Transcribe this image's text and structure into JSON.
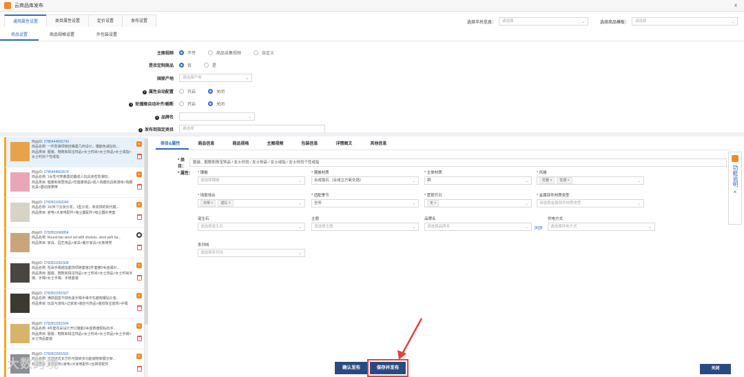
{
  "window": {
    "title": "云商品库发布",
    "close": "x"
  },
  "top_tabs": [
    "通用属性设置",
    "类目属性设置",
    "定价设置",
    "发布设置"
  ],
  "top_selects": {
    "template_label": "选择半托信息：",
    "template_placeholder": "请选择",
    "product_template_label": "选择商品模板：",
    "product_template_placeholder": "请选择"
  },
  "sub_tabs": [
    "商品设置",
    "商品规格设置",
    "外包装设置"
  ],
  "form": {
    "main_video": {
      "label": "主图视频",
      "options": [
        "不传",
        "商品采集视频",
        "自定义"
      ]
    },
    "customized": {
      "label": "是否定制商品",
      "options": [
        "否",
        "是"
      ]
    },
    "origin": {
      "label": "国家产地",
      "placeholder": "请选择产地"
    },
    "auto_attr": {
      "label": "属性自动配置",
      "options": [
        "开启",
        "关闭"
      ]
    },
    "carousel": {
      "label": "轮播图自动补齐/截断",
      "options": [
        "开启",
        "关闭"
      ]
    },
    "brand": {
      "label": "品牌名"
    },
    "publish_category": {
      "label": "发布到指定类目",
      "placeholder": "请选择"
    }
  },
  "products": [
    {
      "id_label": "商品ID:",
      "id": "2786444665743",
      "name_label": "商品名称:",
      "name": "一件防弹项链挂嘴遇几何设计，镶嵌色减钻石...",
      "cat_label": "商品类目:",
      "cat": "服装、鞋靴和珠宝饰品>女士时尚>女士饰品>女士戒指>女士时尚个性戒指"
    },
    {
      "id_label": "商品ID:",
      "id": "2786444653576",
      "name_label": "商品名称:",
      "name": "1女性可穿戴震动器成人玩具亲密防潮玩...",
      "cat_label": "商品类目:",
      "cat": "健康和家居用品>性健康用品>成人情趣玩具和游戏>情趣玩具>震动按摩棒"
    },
    {
      "id_label": "商品ID:",
      "id": "2782811662049",
      "name_label": "商品名称:",
      "name": "10/米寸云状沙发，1型沙发，单双排的现代模...",
      "cat_label": "商品类目:",
      "cat": "家电>大家电配件>吸尘器配件>吸尘器外壳套"
    },
    {
      "id_label": "商品ID:",
      "id": "2782811660854",
      "name_label": "商品名称:",
      "name": "Round bar stool set with shelves, stool with ba...",
      "cat_label": "商品类目:",
      "cat": "家具、园艺用品>家具>餐厅家具>长条椅凳"
    },
    {
      "id_label": "商品ID:",
      "id": "2782811551509",
      "name_label": "商品名称:",
      "name": "花朵手镯戒指套饰项链套装3件套镀24k金属针...",
      "cat_label": "商品类目:",
      "cat": "服装、鞋靴和珠宝饰品>女士时尚>女士饰品>女士时尚手链、手镯>女士手镯、手链套装"
    },
    {
      "id_label": "商品ID:",
      "id": "2782811551507",
      "name_label": "商品名称:",
      "name": "满拼圆盒不掉色黑手镯手串中东越南镶钻沙金...",
      "cat_label": "商品类目:",
      "cat": "玩具与游戏>过家家>装扮与饰品>装扮珠宝首饰>手镯"
    },
    {
      "id_label": "商品ID:",
      "id": "2782811551504",
      "name_label": "商品名称:",
      "name": "4件套花朵设计开口镶嵌24k金数镀铜钻石手...",
      "cat_label": "商品类目:",
      "cat": "服装、鞋靴和珠宝饰品>女士时尚>女士饰品>女士手链>女士饰品套装"
    },
    {
      "id_label": "商品ID:",
      "id": "2782811551502",
      "name_label": "商品名称:",
      "name": "可连续式长方形可旋转多功能储物架展示架...",
      "cat_label": "商品类目:",
      "cat": "家居装饰>家电>大家电配件>丝网零配件"
    }
  ],
  "detail_tabs": [
    "类目&属性",
    "商品信息",
    "商品规格",
    "主图视频",
    "包装信息",
    "详情图文",
    "其他信息"
  ],
  "category": {
    "label": "* 类目：",
    "value": "服装、鞋靴和珠宝饰品 / 女士时尚 / 女士饰品 / 女士戒指 / 女士时尚个性戒指"
  },
  "attributes_label": "* 属性：",
  "attributes": [
    {
      "label": "* 镶嵌",
      "placeholder": "请选择镶嵌",
      "tags": []
    },
    {
      "label": "* 镶嵌材质",
      "placeholder": "合成锆石（合成立方氧化锆）",
      "tags": []
    },
    {
      "label": "* 主体材质",
      "placeholder": "铜",
      "tags": []
    },
    {
      "label": "* 风格",
      "placeholder": "",
      "tags": [
        "优雅",
        "性感"
      ]
    },
    {
      "label": "* 场景场合",
      "placeholder": "",
      "tags": [
        "日常",
        "送礼"
      ]
    },
    {
      "label": "* 适配季节",
      "placeholder": "全年",
      "tags": []
    },
    {
      "label": "* 营销节日",
      "placeholder": "",
      "tags": [
        "无"
      ]
    },
    {
      "label": "* 金属部件材质类型",
      "placeholder": "请选择金属部件材质类型",
      "tags": []
    },
    {
      "label": "诞生石",
      "placeholder": "请选择诞生石",
      "tags": []
    },
    {
      "label": "主题",
      "placeholder": "请选择主题",
      "tags": []
    },
    {
      "label": "品牌名",
      "placeholder": "请选择品牌名",
      "tags": []
    },
    {
      "label": "供电方式",
      "placeholder": "请选择供电方式",
      "tags": []
    },
    {
      "label": "系列线",
      "placeholder": "请选择系列线",
      "tags": []
    }
  ],
  "sync_label": "同步",
  "buttons": {
    "confirm": "确认发布",
    "save_publish": "保存并发布",
    "close": "关闭"
  },
  "side_panel": {
    "text": "功能说明",
    "close": "×"
  },
  "watermark": "大数跨境"
}
